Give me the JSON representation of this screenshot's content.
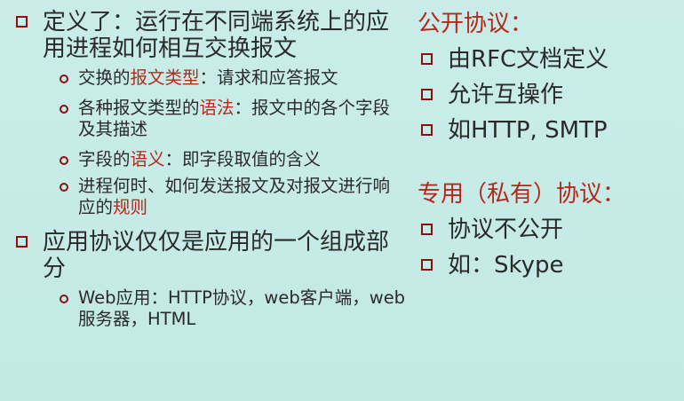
{
  "left": {
    "item1": {
      "text": "定义了：运行在不同端系统上的应用进程如何相互交换报文",
      "subitems": [
        {
          "pre": "交换的",
          "hl": "报文类型",
          "post": "：请求和应答报文"
        },
        {
          "pre": "各种报文类型的",
          "hl": "语法",
          "post": "：报文中的各个字段及其描述"
        },
        {
          "pre": "字段的",
          "hl": "语义",
          "post": "：即字段取值的含义"
        },
        {
          "pre": "进程何时、如何发送报文及对报文进行响应的",
          "hl": "规则",
          "post": ""
        }
      ]
    },
    "item2": {
      "text": "应用协议仅仅是应用的一个组成部分",
      "subitems": [
        {
          "text": "Web应用：HTTP协议，web客户端，web服务器，HTML"
        }
      ]
    }
  },
  "right": {
    "open": {
      "heading": "公开协议：",
      "items": [
        "由RFC文档定义",
        "允许互操作",
        "如HTTP, SMTP"
      ]
    },
    "private": {
      "heading": "专用（私有）协议：",
      "items": [
        "协议不公开",
        "如：Skype"
      ]
    }
  }
}
